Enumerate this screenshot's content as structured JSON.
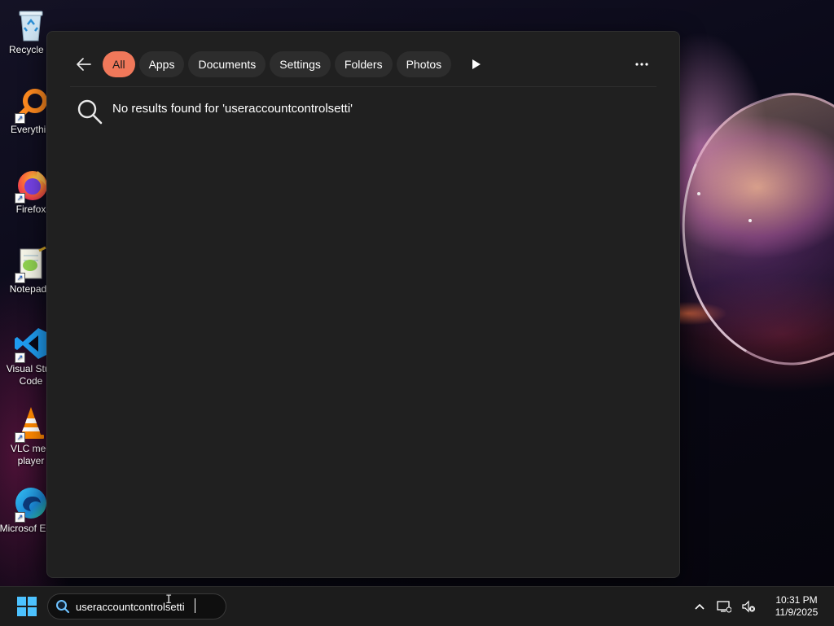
{
  "desktop": {
    "icons": [
      {
        "label": "Recycle B",
        "icon": "recycle-bin-icon"
      },
      {
        "label": "Everythin",
        "icon": "everything-search-icon"
      },
      {
        "label": "Firefox",
        "icon": "firefox-icon"
      },
      {
        "label": "Notepad+",
        "icon": "notepad-plus-plus-icon"
      },
      {
        "label": "Visual Stud Code",
        "icon": "vscode-icon"
      },
      {
        "label": "VLC med player",
        "icon": "vlc-icon"
      },
      {
        "label": "Microsof Edge",
        "icon": "edge-icon"
      }
    ]
  },
  "search_flyout": {
    "filters": [
      {
        "label": "All",
        "active": true
      },
      {
        "label": "Apps",
        "active": false
      },
      {
        "label": "Documents",
        "active": false
      },
      {
        "label": "Settings",
        "active": false
      },
      {
        "label": "Folders",
        "active": false
      },
      {
        "label": "Photos",
        "active": false
      }
    ],
    "no_results_message": "No results found for 'useraccountcontrolsetti'",
    "accent_color": "#f0785a"
  },
  "taskbar": {
    "search_value": "useraccountcontrolsetti",
    "clock_time": "10:31 PM",
    "clock_date": "11/9/2025"
  }
}
